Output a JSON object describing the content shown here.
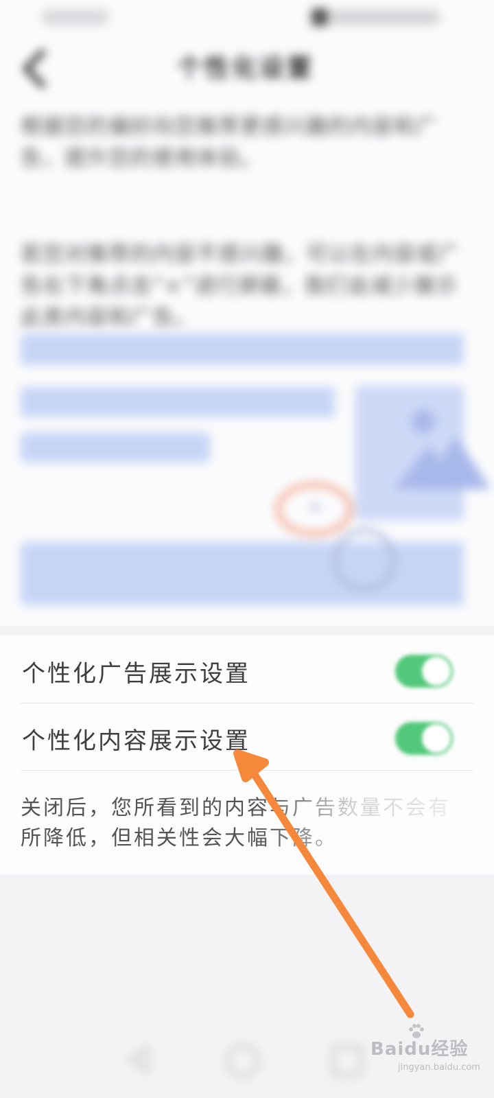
{
  "status_bar": {},
  "header": {
    "title": "个性化设置",
    "back_icon": "chevron-left-icon"
  },
  "description": {
    "paragraph_1": "根据您的偏好向您推荐更感兴趣的内容和广告，提升您的使用体验。",
    "paragraph_2": "若您对推荐的内容不感兴趣，可以在内容或广告右下角点击“×”进行屏蔽，我们会减少展示此类内容和广告。"
  },
  "illustration": {
    "close_icon": "close-icon",
    "pointer_icon": "hand-pointer-icon",
    "image_icon": "image-placeholder-icon",
    "colors": {
      "block": "#c7d5f5",
      "highlight_ring": "#f3a488"
    }
  },
  "settings": {
    "items": [
      {
        "label": "个性化广告展示设置",
        "enabled": true
      },
      {
        "label": "个性化内容展示设置",
        "enabled": true
      }
    ],
    "note": "关闭后，您所看到的内容与广告数量不会有所降低，但相关性会大幅下降。",
    "toggle_color": "#52c87a"
  },
  "annotation": {
    "arrow_color": "#f5883a"
  },
  "navbar": {
    "back_icon": "nav-back-icon",
    "home_icon": "nav-home-icon",
    "recent_icon": "nav-recent-icon"
  },
  "watermark": {
    "text": "Baidu经验",
    "sub": "jingyan.baidu.com"
  }
}
